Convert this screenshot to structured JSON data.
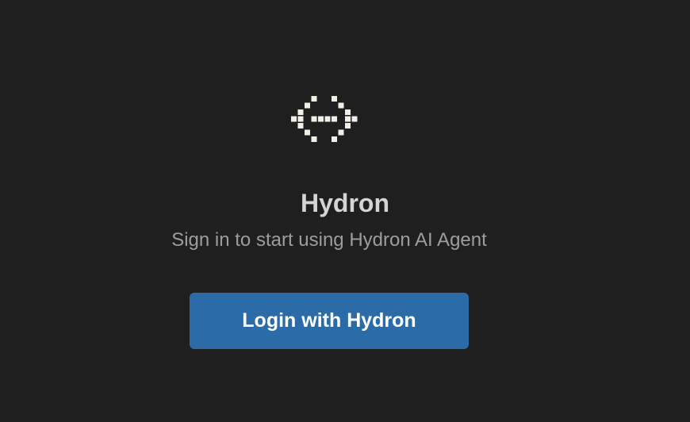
{
  "logo": {
    "icon": "hydron-pixel-logo-icon",
    "color": "#f2f0e6"
  },
  "title": "Hydron",
  "subtitle": "Sign in to start using Hydron AI Agent",
  "login_button": {
    "label": "Login with Hydron",
    "color": "#2b6ca8"
  },
  "colors": {
    "background": "#1f1f1f",
    "title": "#d4d4d4",
    "subtitle": "#9d9d9d"
  }
}
